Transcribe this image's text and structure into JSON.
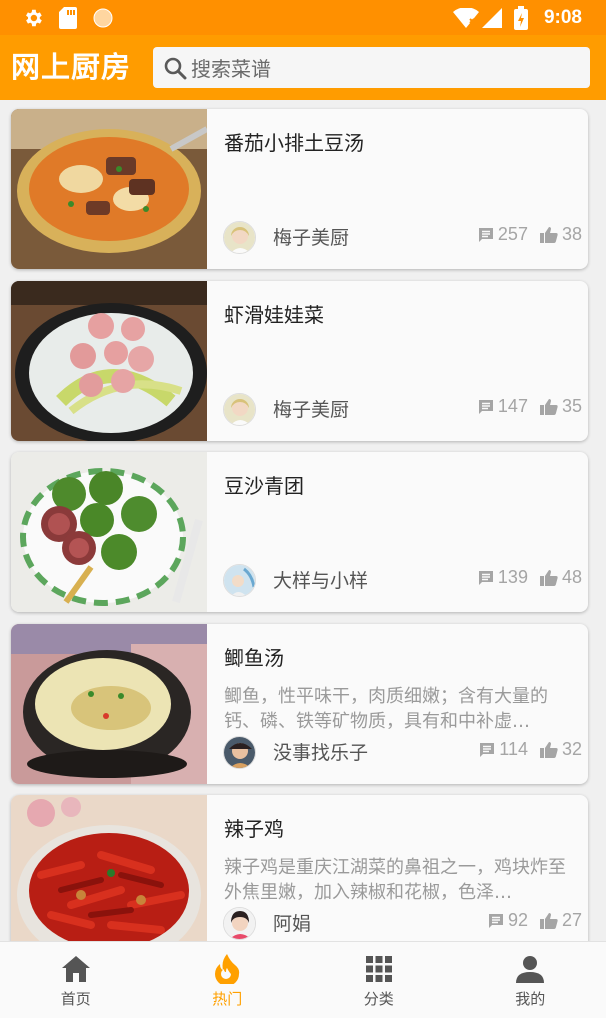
{
  "status_bar": {
    "time": "9:08",
    "icons": [
      "gear-icon",
      "sd-card-icon",
      "circle-icon",
      "wifi-icon",
      "signal-icon",
      "battery-charging-icon"
    ]
  },
  "app_bar": {
    "title": "网上厨房",
    "search_placeholder": "搜索菜谱"
  },
  "recipes": [
    {
      "title": "番茄小排土豆汤",
      "description": "",
      "author": "梅子美厨",
      "comments": "257",
      "likes": "38"
    },
    {
      "title": "虾滑娃娃菜",
      "description": "",
      "author": "梅子美厨",
      "comments": "147",
      "likes": "35"
    },
    {
      "title": "豆沙青团",
      "description": "",
      "author": "大样与小样",
      "comments": "139",
      "likes": "48"
    },
    {
      "title": "鲫鱼汤",
      "description": "鲫鱼，性平味干，肉质细嫩；含有大量的钙、磷、铁等矿物质，具有和中补虚…",
      "author": "没事找乐子",
      "comments": "114",
      "likes": "32"
    },
    {
      "title": "辣子鸡",
      "description": "辣子鸡是重庆江湖菜的鼻祖之一，鸡块炸至外焦里嫩，加入辣椒和花椒，色泽…",
      "author": "阿娟",
      "comments": "92",
      "likes": "27"
    }
  ],
  "bottom_nav": [
    {
      "label": "首页",
      "icon": "home-icon",
      "active": false
    },
    {
      "label": "热门",
      "icon": "flame-icon",
      "active": true
    },
    {
      "label": "分类",
      "icon": "grid-icon",
      "active": false
    },
    {
      "label": "我的",
      "icon": "person-icon",
      "active": false
    }
  ],
  "colors": {
    "status_bar": "#ff9000",
    "app_bar": "#ff9c00",
    "accent": "#ffa000",
    "card_bg": "#fafafa"
  }
}
